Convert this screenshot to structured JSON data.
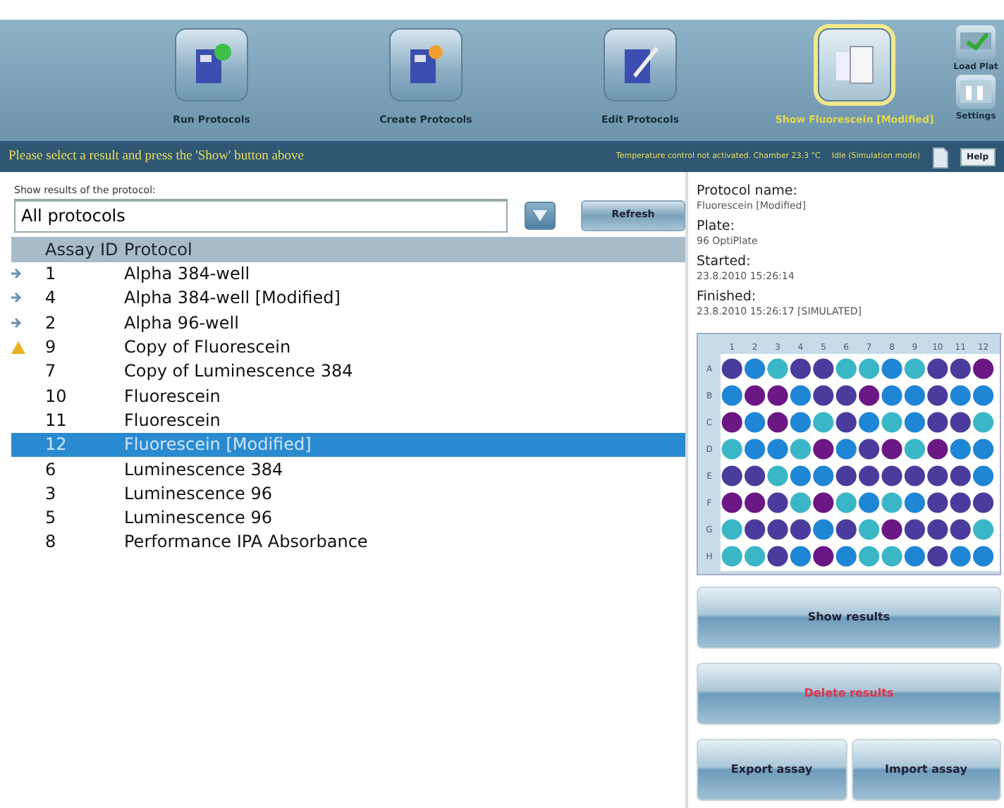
{
  "toolbar": {
    "items": [
      {
        "label": "Run Protocols",
        "kind": "run",
        "selected": false
      },
      {
        "label": "Create Protocols",
        "kind": "create",
        "selected": false
      },
      {
        "label": "Edit Protocols",
        "kind": "edit",
        "selected": false
      },
      {
        "label": "Show Fluorescein [Modified]",
        "kind": "show",
        "selected": true
      }
    ],
    "side_items": [
      {
        "label": "Load Plat",
        "kind": "load"
      },
      {
        "label": "Settings",
        "kind": "settings"
      }
    ]
  },
  "status_bar": {
    "message": "Please select a result and press the 'Show' button above",
    "temperature": "Temperature control not activated. Chamber 23.3 °C",
    "mode": "Idle (Simulation mode)",
    "help": "Help"
  },
  "filter": {
    "label": "Show results of the protocol:",
    "value": "All protocols",
    "refresh": "Refresh"
  },
  "table": {
    "columns": [
      "Assay ID",
      "Protocol"
    ],
    "rows": [
      {
        "id": "1",
        "protocol": "Alpha 384-well",
        "kind": "expandable",
        "selected": false
      },
      {
        "id": "4",
        "protocol": "Alpha 384-well [Modified]",
        "kind": "expandable",
        "selected": false
      },
      {
        "id": "2",
        "protocol": "Alpha 96-well",
        "kind": "expandable",
        "selected": false
      },
      {
        "id": "9",
        "protocol": "Copy of Fluorescein",
        "kind": "warning",
        "selected": false
      },
      {
        "id": "7",
        "protocol": "Copy of Luminescence 384",
        "kind": "plain",
        "selected": false
      },
      {
        "id": "10",
        "protocol": "Fluorescein",
        "kind": "plain",
        "selected": false
      },
      {
        "id": "11",
        "protocol": "Fluorescein",
        "kind": "plain",
        "selected": false
      },
      {
        "id": "12",
        "protocol": "Fluorescein [Modified]",
        "kind": "plain",
        "selected": true
      },
      {
        "id": "6",
        "protocol": "Luminescence 384",
        "kind": "plain",
        "selected": false
      },
      {
        "id": "3",
        "protocol": "Luminescence 96",
        "kind": "plain",
        "selected": false
      },
      {
        "id": "5",
        "protocol": "Luminescence 96",
        "kind": "plain",
        "selected": false
      },
      {
        "id": "8",
        "protocol": "Performance IPA Absorbance",
        "kind": "plain",
        "selected": false
      }
    ]
  },
  "details": [
    {
      "label": "Protocol name:",
      "value": "Fluorescein [Modified]"
    },
    {
      "label": "Plate:",
      "value": "96 OptiPlate"
    },
    {
      "label": "Started:",
      "value": "23.8.2010 15:26:14"
    },
    {
      "label": "Finished:",
      "value": "23.8.2010 15:26:17 [SIMULATED]"
    }
  ],
  "plate": {
    "columns": [
      "1",
      "2",
      "3",
      "4",
      "5",
      "6",
      "7",
      "8",
      "9",
      "10",
      "11",
      "12"
    ],
    "rows": [
      {
        "label": "A",
        "wells": [
          {
            "color": "#4a3c9c"
          },
          {
            "color": "#1f86d6"
          },
          {
            "color": "#3bb6c6"
          },
          {
            "color": "#4a3c9c"
          },
          {
            "color": "#4a3c9c"
          },
          {
            "color": "#3bb6c6"
          },
          {
            "color": "#3bb6c6"
          },
          {
            "color": "#1f86d6"
          },
          {
            "color": "#3bb6c6"
          },
          {
            "color": "#4a3c9c"
          },
          {
            "color": "#4a3c9c"
          },
          {
            "color": "#6b1784"
          }
        ]
      },
      {
        "label": "B",
        "wells": [
          {
            "color": "#1f86d6"
          },
          {
            "color": "#6b1784"
          },
          {
            "color": "#6b1784"
          },
          {
            "color": "#1f86d6"
          },
          {
            "color": "#4a3c9c"
          },
          {
            "color": "#4a3c9c"
          },
          {
            "color": "#6b1784"
          },
          {
            "color": "#1f86d6"
          },
          {
            "color": "#1f86d6"
          },
          {
            "color": "#4a3c9c"
          },
          {
            "color": "#1f86d6"
          },
          {
            "color": "#1f86d6"
          }
        ]
      },
      {
        "label": "C",
        "wells": [
          {
            "color": "#6b1784"
          },
          {
            "color": "#1f86d6"
          },
          {
            "color": "#6b1784"
          },
          {
            "color": "#1f86d6"
          },
          {
            "color": "#3bb6c6"
          },
          {
            "color": "#4a3c9c"
          },
          {
            "color": "#1f86d6"
          },
          {
            "color": "#3bb6c6"
          },
          {
            "color": "#1f86d6"
          },
          {
            "color": "#4a3c9c"
          },
          {
            "color": "#4a3c9c"
          },
          {
            "color": "#3bb6c6"
          }
        ]
      },
      {
        "label": "D",
        "wells": [
          {
            "color": "#3bb6c6"
          },
          {
            "color": "#1f86d6"
          },
          {
            "color": "#1f86d6"
          },
          {
            "color": "#3bb6c6"
          },
          {
            "color": "#6b1784"
          },
          {
            "color": "#1f86d6"
          },
          {
            "color": "#4a3c9c"
          },
          {
            "color": "#6b1784"
          },
          {
            "color": "#3bb6c6"
          },
          {
            "color": "#6b1784"
          },
          {
            "color": "#1f86d6"
          },
          {
            "color": "#1f86d6"
          }
        ]
      },
      {
        "label": "E",
        "wells": [
          {
            "color": "#4a3c9c"
          },
          {
            "color": "#4a3c9c"
          },
          {
            "color": "#3bb6c6"
          },
          {
            "color": "#1f86d6"
          },
          {
            "color": "#1f86d6"
          },
          {
            "color": "#4a3c9c"
          },
          {
            "color": "#4a3c9c"
          },
          {
            "color": "#4a3c9c"
          },
          {
            "color": "#4a3c9c"
          },
          {
            "color": "#4a3c9c"
          },
          {
            "color": "#4a3c9c"
          },
          {
            "color": "#1f86d6"
          }
        ]
      },
      {
        "label": "F",
        "wells": [
          {
            "color": "#6b1784"
          },
          {
            "color": "#6b1784"
          },
          {
            "color": "#4a3c9c"
          },
          {
            "color": "#3bb6c6"
          },
          {
            "color": "#6b1784"
          },
          {
            "color": "#3bb6c6"
          },
          {
            "color": "#1f86d6"
          },
          {
            "color": "#3bb6c6"
          },
          {
            "color": "#1f86d6"
          },
          {
            "color": "#4a3c9c"
          },
          {
            "color": "#4a3c9c"
          },
          {
            "color": "#4a3c9c"
          }
        ]
      },
      {
        "label": "G",
        "wells": [
          {
            "color": "#3bb6c6"
          },
          {
            "color": "#4a3c9c"
          },
          {
            "color": "#4a3c9c"
          },
          {
            "color": "#4a3c9c"
          },
          {
            "color": "#1f86d6"
          },
          {
            "color": "#4a3c9c"
          },
          {
            "color": "#3bb6c6"
          },
          {
            "color": "#6b1784"
          },
          {
            "color": "#4a3c9c"
          },
          {
            "color": "#4a3c9c"
          },
          {
            "color": "#4a3c9c"
          },
          {
            "color": "#3bb6c6"
          }
        ]
      },
      {
        "label": "H",
        "wells": [
          {
            "color": "#3bb6c6"
          },
          {
            "color": "#3bb6c6"
          },
          {
            "color": "#4a3c9c"
          },
          {
            "color": "#1f86d6"
          },
          {
            "color": "#6b1784"
          },
          {
            "color": "#1f86d6"
          },
          {
            "color": "#3bb6c6"
          },
          {
            "color": "#3bb6c6"
          },
          {
            "color": "#1f86d6"
          },
          {
            "color": "#4a3c9c"
          },
          {
            "color": "#1f86d6"
          },
          {
            "color": "#1f86d6"
          }
        ]
      }
    ]
  },
  "actions": [
    {
      "label": "Show results",
      "kind": "normal"
    },
    {
      "label": "Delete results",
      "kind": "danger"
    },
    {
      "label": "Export assay",
      "kind": "half"
    },
    {
      "label": "Import assay",
      "kind": "half"
    }
  ]
}
